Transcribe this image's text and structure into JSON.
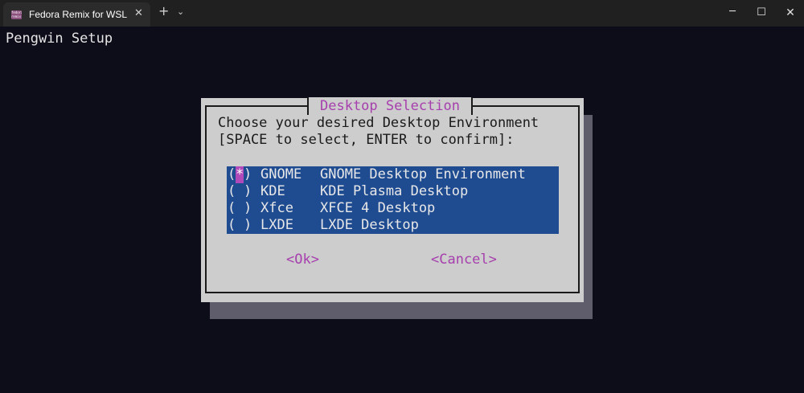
{
  "window": {
    "tab_title": "Fedora Remix for WSL",
    "tab_icon_text": "fedora remix",
    "close_tab_glyph": "✕",
    "new_tab_glyph": "+",
    "dropdown_glyph": "⌄",
    "minimize_glyph": "─",
    "maximize_glyph": "☐",
    "close_glyph": "✕"
  },
  "terminal": {
    "header": "Pengwin Setup"
  },
  "dialog": {
    "title": "Desktop Selection",
    "prompt_line1": "Choose your desired Desktop Environment",
    "prompt_line2": "[SPACE to select, ENTER to confirm]:",
    "items": [
      {
        "mark_open": "(",
        "mark": "*",
        "mark_close": ")",
        "tag": "GNOME",
        "description": "GNOME Desktop Environment"
      },
      {
        "mark_open": "(",
        "mark": " ",
        "mark_close": ")",
        "tag": "KDE",
        "description": "KDE Plasma Desktop"
      },
      {
        "mark_open": "(",
        "mark": " ",
        "mark_close": ")",
        "tag": "Xfce",
        "description": "XFCE 4 Desktop"
      },
      {
        "mark_open": "(",
        "mark": " ",
        "mark_close": ")",
        "tag": "LXDE",
        "description": "LXDE Desktop"
      }
    ],
    "ok_label": "<Ok>",
    "cancel_label": "<Cancel>"
  },
  "colors": {
    "terminal_bg": "#0d0c19",
    "dialog_bg": "#cdcdcd",
    "menu_bg": "#1f4b91",
    "accent": "#a63fad"
  }
}
